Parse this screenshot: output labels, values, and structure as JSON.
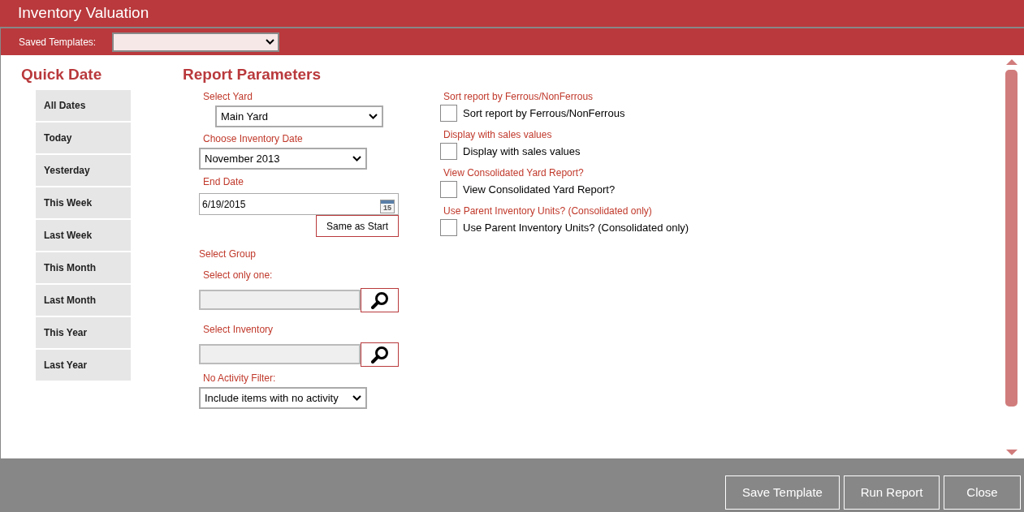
{
  "window": {
    "title": "Inventory Valuation"
  },
  "toolbar": {
    "label": "Saved Templates:"
  },
  "quick_date": {
    "title": "Quick Date",
    "items": [
      {
        "label": "All Dates"
      },
      {
        "label": "Today"
      },
      {
        "label": "Yesterday"
      },
      {
        "label": "This Week"
      },
      {
        "label": "Last Week"
      },
      {
        "label": "This Month"
      },
      {
        "label": "Last Month"
      },
      {
        "label": "This Year"
      },
      {
        "label": "Last Year"
      }
    ]
  },
  "report_parameters": {
    "title": "Report Parameters",
    "fields": [
      {
        "kind": "select",
        "label": "Select Yard",
        "value": "Main Yard"
      },
      {
        "kind": "select",
        "label": "Choose Inventory Date",
        "value": "November 2013"
      },
      {
        "kind": "date",
        "label": "End Date",
        "value": "6/19/2015",
        "calendar_day": "15",
        "button": "Same as Start"
      },
      {
        "kind": "heading",
        "label": "Select Group"
      },
      {
        "kind": "lookup",
        "label": "Select only one:"
      },
      {
        "kind": "lookup",
        "label": "Select Inventory"
      },
      {
        "kind": "select",
        "label": "No Activity Filter:",
        "value": "Include items with no activity"
      }
    ]
  },
  "options": [
    {
      "caption": "Sort report by Ferrous/NonFerrous",
      "label": "Sort report by Ferrous/NonFerrous",
      "checked": false
    },
    {
      "caption": "Display with sales values",
      "label": "Display with sales values",
      "checked": false
    },
    {
      "caption": "View Consolidated Yard Report?",
      "label": "View Consolidated Yard Report?",
      "checked": false
    },
    {
      "caption": "Use Parent Inventory Units? (Consolidated only)",
      "label": "Use Parent Inventory Units? (Consolidated only)",
      "checked": false
    }
  ],
  "footer_buttons": [
    "Save Template",
    "Run Report",
    "Close"
  ]
}
